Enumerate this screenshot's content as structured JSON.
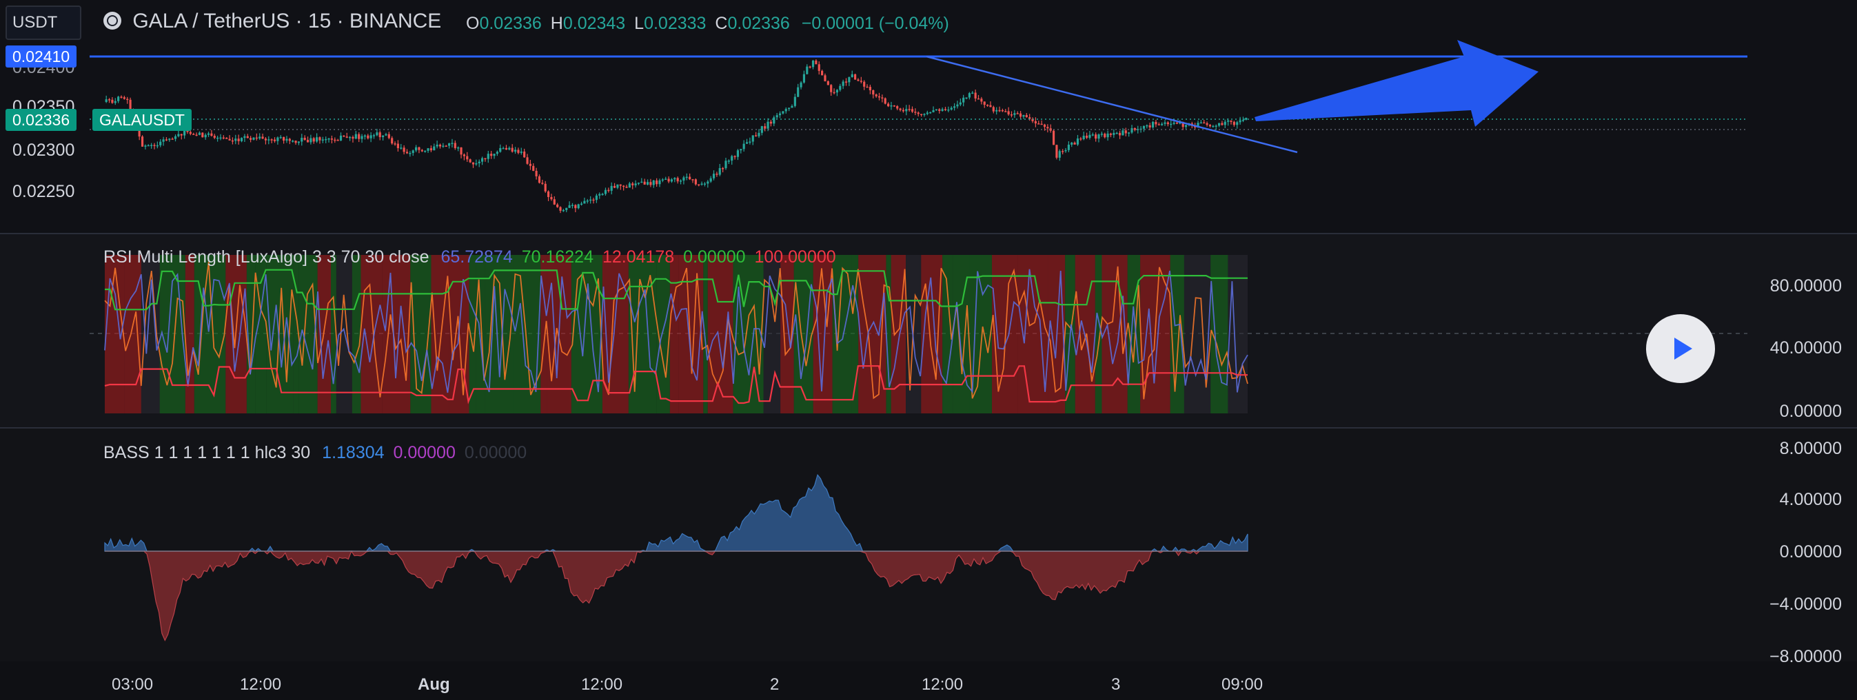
{
  "symbol_search": {
    "value": "USDT"
  },
  "header": {
    "title": "GALA / TetherUS · 15 · BINANCE",
    "ohlc": {
      "o_label": "O",
      "o_value": "0.02336",
      "h_label": "H",
      "h_value": "0.02343",
      "l_label": "L",
      "l_value": "0.02333",
      "c_label": "C",
      "c_value": "0.02336",
      "change": "−0.00001 (−0.04%)"
    }
  },
  "price_pane": {
    "y_labels": [
      "0.02400",
      "0.02350",
      "0.02300",
      "0.02250"
    ],
    "hline_tag": "0.02410",
    "last_price_tag": "0.02336",
    "symbol_tag": "GALAUSDT"
  },
  "rsi_pane": {
    "name": "RSI Multi Length [LuxAlgo] 3 3 70 30 close",
    "values": [
      "65.72874",
      "70.16224",
      "12.04178",
      "0.00000",
      "100.00000"
    ],
    "value_colors": [
      "#5b6bd8",
      "#2ebd3a",
      "#f23645",
      "#2ebd3a",
      "#f23645"
    ],
    "y_labels": [
      "80.00000",
      "40.00000",
      "0.00000"
    ]
  },
  "bass_pane": {
    "name": "BASS 1 1 1 1 1 1 1 hlc3 30",
    "values": [
      "1.18304",
      "0.00000",
      "0.00000"
    ],
    "value_colors": [
      "#3d8ae6",
      "#b040c8",
      "#363a45"
    ],
    "y_labels": [
      "8.00000",
      "4.00000",
      "0.00000",
      "−4.00000",
      "−8.00000"
    ]
  },
  "time_axis": [
    "03:00",
    "12:00",
    "Aug",
    "12:00",
    "2",
    "12:00",
    "3",
    "09:00"
  ],
  "colors": {
    "up": "#26a69a",
    "down": "#ef5350",
    "accent": "#2962ff",
    "rsi_green": "#1fb11f",
    "rsi_red": "#f23645",
    "bass_blue": "#2f5f9a",
    "bass_red": "#8a2f33"
  }
}
